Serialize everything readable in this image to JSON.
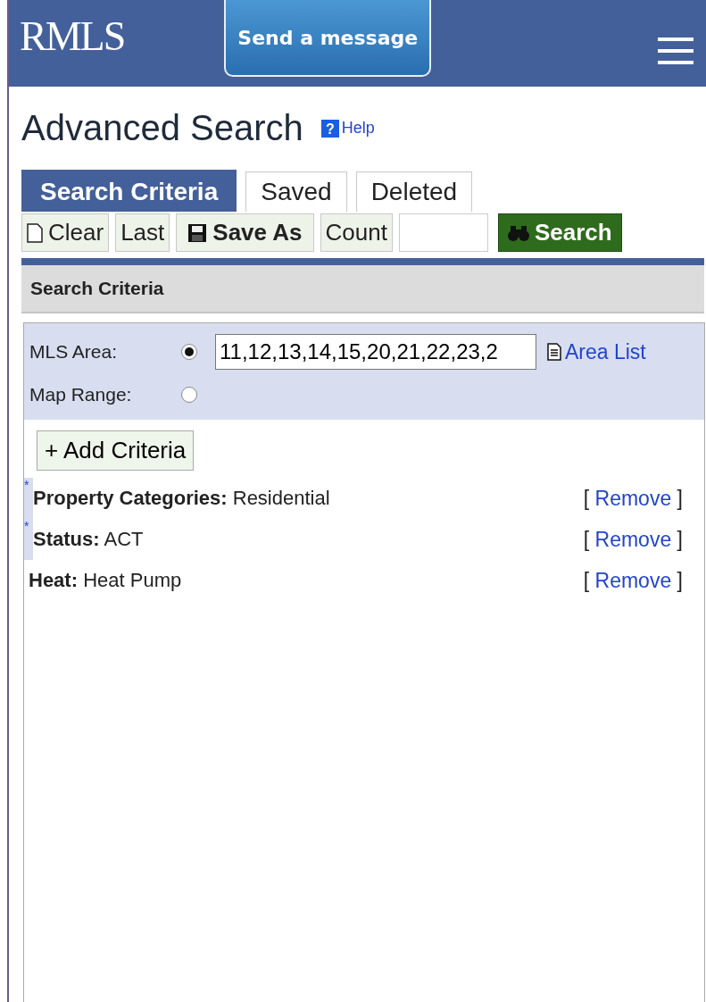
{
  "header": {
    "logo": "RMLS",
    "message_button": "Send a message"
  },
  "page": {
    "title": "Advanced Search",
    "help_icon": "?",
    "help": "Help"
  },
  "tabs": [
    {
      "label": "Search Criteria",
      "selected": true
    },
    {
      "label": "Saved",
      "selected": false
    },
    {
      "label": "Deleted",
      "selected": false
    }
  ],
  "toolbar": {
    "clear": "Clear",
    "last": "Last",
    "save_as": "Save As",
    "count": "Count",
    "search": "Search"
  },
  "section": {
    "title": "Search Criteria"
  },
  "location": [
    {
      "label": "MLS Area:",
      "selected": true,
      "value": "11,12,13,14,15,20,21,22,23,2",
      "link": "Area List"
    },
    {
      "label": "Map Range:",
      "selected": false
    }
  ],
  "add_button": "+ Add Criteria",
  "criteria": [
    {
      "marker": "*",
      "label": "Property Categories:",
      "value": "Residential",
      "remove": {
        "open": "[",
        "link": "Remove",
        "close": "]"
      }
    },
    {
      "marker": "*",
      "label": "Status:",
      "value": "ACT",
      "remove": {
        "open": "[",
        "link": "Remove",
        "close": "]"
      }
    },
    {
      "label": "Heat:",
      "value": "Heat Pump",
      "remove": {
        "open": "[",
        "link": "Remove",
        "close": "]"
      }
    }
  ]
}
